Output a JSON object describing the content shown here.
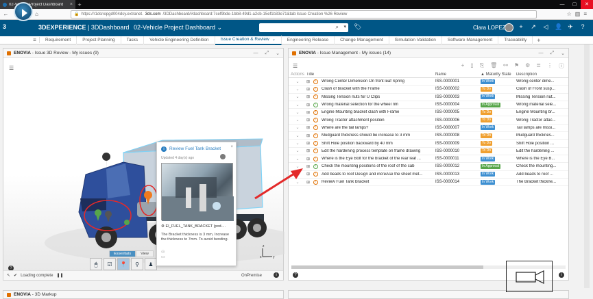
{
  "browser": {
    "tab_title": "02-Vehicle Project Dashboard",
    "url_prefix": "https://r1dsnopgd004dsy.extranet.",
    "url_host": "3ds.com",
    "url_suffix": "/3DDashboard/#dashboard:7cef9bde-1bb8-49d1-a2cb-15ef1b33e71&tab:Issue Creation %26 Review"
  },
  "app": {
    "brand": "3DEXPERIENCE",
    "separator": " | ",
    "module": "3DDashboard",
    "dashboard": "02-Vehicle Project Dashboard",
    "user": "Clara LOPEZ"
  },
  "dashboard_tabs": [
    "Requirement",
    "Project Planning",
    "Tasks",
    "Vehicle Engineering Definition",
    "Issue Creation & Review",
    "Engineering Release",
    "Change Management",
    "Simulation Validation",
    "Software Management",
    "Traceability"
  ],
  "left_panel": {
    "app": "ENOVIA",
    "title": " - Issue 3D Review - My issues (9)",
    "status": "Loading complete",
    "server": "OnPremise",
    "view_tabs": [
      "Essentials",
      "View"
    ]
  },
  "card": {
    "title": "Review Fuel Tank Bracket",
    "updated": "Updated 4 day(s) ago",
    "file": "EI_FUEL_TANK_BRACKET (pod-...",
    "description": "The Bracket thickness is 3 mm, Increase the thickness to 7mm. To avoid bending."
  },
  "right_panel": {
    "app": "ENOVIA",
    "title": " - Issue Management - My issues (14)",
    "columns": {
      "actions": "Actions",
      "title": "Title",
      "name": "Name",
      "state": "Maturity State",
      "desc": "Description"
    },
    "rows": [
      {
        "title": "Wrong Center Dimension On front leaf Spring",
        "name": "ISS-0000001",
        "state": "In Work",
        "desc": "Wrong center dime..."
      },
      {
        "title": "Clash of bracket with the Frame",
        "name": "ISS-0000002",
        "state": "To Do",
        "desc": "Clash of Front susp..."
      },
      {
        "title": "Missing Tension nuts for U Clips",
        "name": "ISS-0000003",
        "state": "In Work",
        "desc": "Missing Tension nut..."
      },
      {
        "title": "Wrong material selection for the wheel rim",
        "name": "ISS-0000004",
        "state": "In Approval",
        "desc": "Wrong material sele..."
      },
      {
        "title": "Engine Mounting bracket clash with Frame",
        "name": "ISS-0000005",
        "state": "To Do",
        "desc": "Engine Mounting br..."
      },
      {
        "title": "Wrong Tractor attachment position",
        "name": "ISS-0000006",
        "state": "To Do",
        "desc": "Wrong Tractor attac..."
      },
      {
        "title": "Where are the tail lamps?",
        "name": "ISS-0000007",
        "state": "In Work",
        "desc": "Tail lamps are missi..."
      },
      {
        "title": "Mudguard thickness should be increase to 3 mm",
        "name": "ISS-0000008",
        "state": "To Do",
        "desc": "Mudguard thicknes..."
      },
      {
        "title": "Shift Hole position backward by 40 mm",
        "name": "ISS-0000009",
        "state": "To Do",
        "desc": "Shift Hole position ..."
      },
      {
        "title": "Edit the hardening process template on frame drawing",
        "name": "ISS-0000010",
        "state": "To Do",
        "desc": "Edit the hardening ..."
      },
      {
        "title": "Where is the Eye Bolt for the bracket of the rear leaf ...",
        "name": "ISS-0000011",
        "state": "In Work",
        "desc": "Where is the Eye B..."
      },
      {
        "title": "Check the mounting positions of the roof of the cab",
        "name": "ISS-0000012",
        "state": "In Approval",
        "desc": "Check the mounting..."
      },
      {
        "title": "Add beads to roof Design and increAse the sheet met...",
        "name": "ISS-0000013",
        "state": "In Work",
        "desc": "Add beads to roof ..."
      },
      {
        "title": "Review Fuel Tank Bracket",
        "name": "ISS-0000014",
        "state": "In Work",
        "desc": "The Bracket thickne..."
      }
    ]
  },
  "bottom_panel": {
    "app": "ENOVIA",
    "title": " - 3D Markup"
  },
  "colors": {
    "in_work": "#3d8fd1",
    "to_do": "#f0a030",
    "in_approval": "#57a64a",
    "brand": "#005686"
  }
}
